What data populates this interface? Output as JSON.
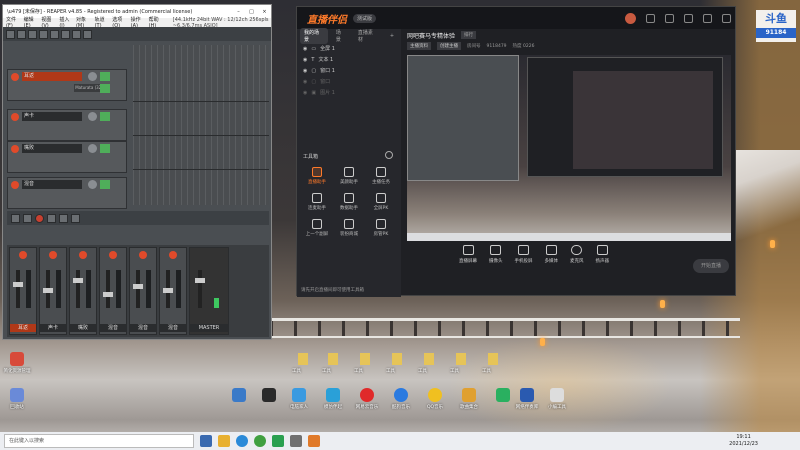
{
  "reaper": {
    "title": "\\u479 [未保存] - REAPER v4.85 - Registered to admin (Commercial license)",
    "menu": [
      "文件(F)",
      "编辑(E)",
      "视图(V)",
      "插入(I)",
      "对象(M)",
      "轨道(T)",
      "选项(O)",
      "操作(A)",
      "帮助(H)"
    ],
    "status": "[44.1kHz 24bit WAV : 12/12ch 256spls ~6.3/6.7ms ASIO]",
    "tracks": [
      {
        "name": "耳返"
      },
      {
        "name": "声卡"
      },
      {
        "name": "嘴败"
      },
      {
        "name": "混音"
      }
    ],
    "fx_label": "Maturata (32)",
    "mixer": {
      "channels": [
        "耳返",
        "声卡",
        "嘴败",
        "混音",
        "混音",
        "混音"
      ],
      "master_label": "MASTER"
    }
  },
  "app": {
    "logo": "直播伴侣",
    "badge": "测试版",
    "scene_tabs": [
      "我的场景",
      "场景",
      "直播素材"
    ],
    "sources": [
      {
        "label": "全屏 1",
        "dim": false
      },
      {
        "label": "文本 1",
        "dim": false
      },
      {
        "label": "窗口 1",
        "dim": false
      },
      {
        "label": "窗口",
        "dim": true
      },
      {
        "label": "图片 1",
        "dim": true
      }
    ],
    "toolbox_label": "工具箱",
    "tools": [
      {
        "label": "直播助手",
        "active": true
      },
      {
        "label": "美颜助手",
        "active": false
      },
      {
        "label": "主播任务",
        "active": false
      },
      {
        "label": "连麦助手",
        "active": false
      },
      {
        "label": "数据助手",
        "active": false
      },
      {
        "label": "全屏PK",
        "active": false
      },
      {
        "label": "上一个副屏",
        "active": false
      },
      {
        "label": "装扮商城",
        "active": false
      },
      {
        "label": "房管PK",
        "active": false
      }
    ],
    "notice": "请先开启直播间即可使用工具箱",
    "room_title": "网吧赛马专精体验",
    "room_tag": "排行",
    "info": [
      "主播资料",
      "创建主播",
      "房间号",
      "9118479",
      "热度 0226"
    ],
    "controls": [
      "直播屏幕",
      "摄像头",
      "手机投屏",
      "多媒体",
      "麦克风",
      "扬声器"
    ],
    "golive": "开始直播"
  },
  "desktop": {
    "icons": [
      "简化资源管理",
      "回收站",
      "电脑家人",
      "模仿伴起",
      "网易云音乐",
      "酷狗音乐",
      "QQ音乐",
      "歌曲集合",
      "网络伴奏库",
      "小编工具"
    ],
    "folders": [
      "工具",
      "工具",
      "工具",
      "工具",
      "工具",
      "工具",
      "工具"
    ]
  },
  "taskbar": {
    "search": "在此键入以搜索",
    "time": "19:11",
    "date": "2021/12/23"
  },
  "douyu": {
    "logo": "斗鱼",
    "room": "91184"
  }
}
